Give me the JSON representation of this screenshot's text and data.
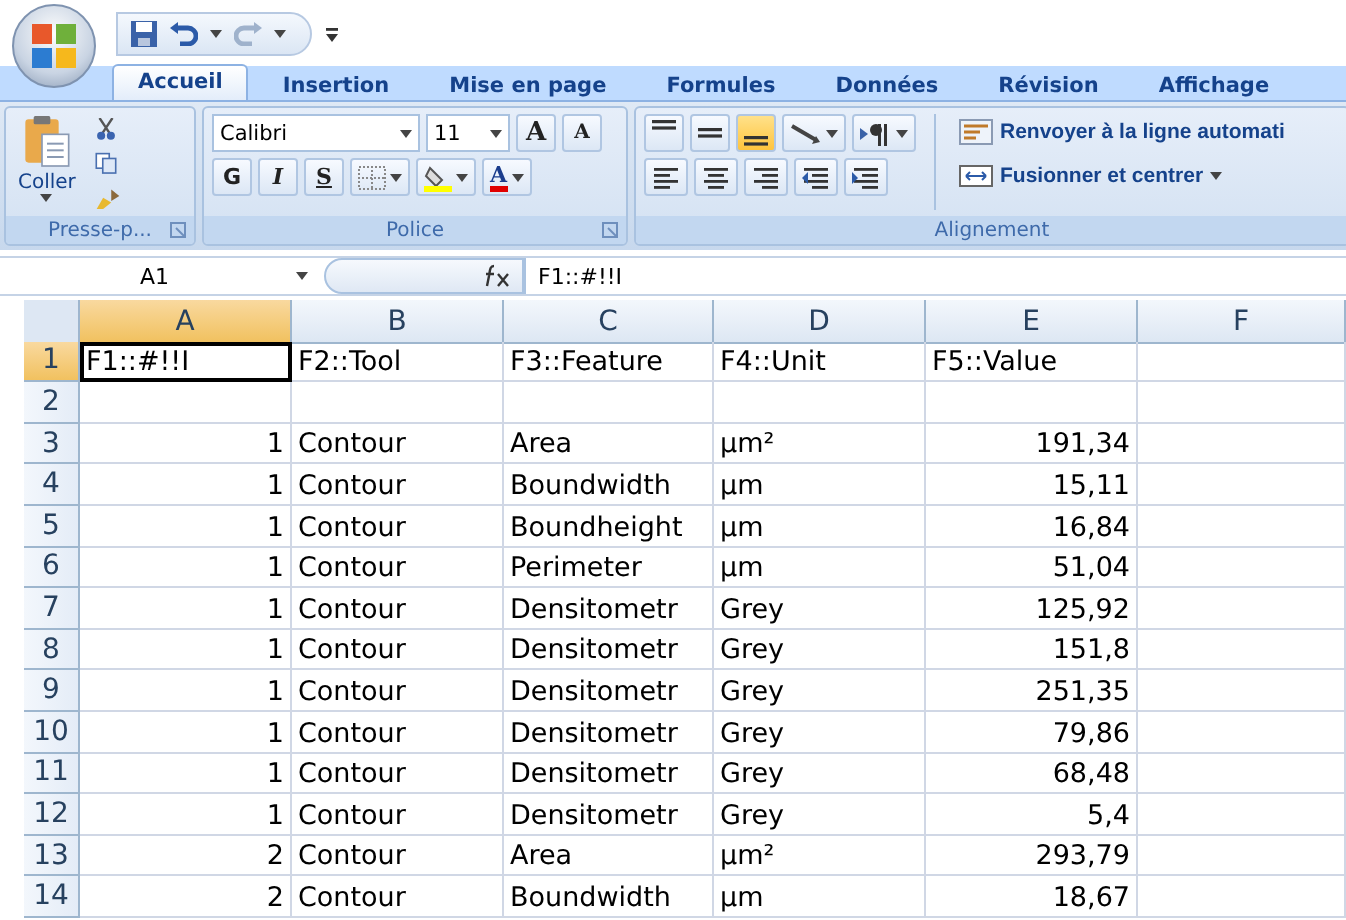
{
  "tabs": [
    {
      "label": "Accueil",
      "selected": true
    },
    {
      "label": "Insertion",
      "selected": false
    },
    {
      "label": "Mise en page",
      "selected": false
    },
    {
      "label": "Formules",
      "selected": false
    },
    {
      "label": "Données",
      "selected": false
    },
    {
      "label": "Révision",
      "selected": false
    },
    {
      "label": "Affichage",
      "selected": false
    }
  ],
  "clipboard": {
    "paste_label": "Coller",
    "group_label": "Presse-p..."
  },
  "font": {
    "name": "Calibri",
    "size": "11",
    "grow": "A",
    "shrink": "A",
    "bold": "G",
    "italic": "I",
    "underline": "S",
    "color_letter": "A",
    "group_label": "Police"
  },
  "alignment": {
    "vertical": [
      {
        "kind": "top",
        "selected": false
      },
      {
        "kind": "middle",
        "selected": false
      },
      {
        "kind": "bottom",
        "selected": true
      }
    ],
    "wrap": "Renvoyer à la ligne automati",
    "merge": "Fusionner et centrer",
    "group_label": "Alignement"
  },
  "formula_bar": {
    "name_box": "A1",
    "formula": "F1::#!!I"
  },
  "columns": [
    {
      "label": "A",
      "selected": true,
      "numeric": true
    },
    {
      "label": "B",
      "selected": false,
      "numeric": false
    },
    {
      "label": "C",
      "selected": false,
      "numeric": false
    },
    {
      "label": "D",
      "selected": false,
      "numeric": false
    },
    {
      "label": "E",
      "selected": false,
      "numeric": true
    },
    {
      "label": "F",
      "selected": false,
      "numeric": false
    }
  ],
  "rows": [
    {
      "label": "1",
      "selected": true,
      "kind": "header",
      "cells": [
        "F1::#!!I",
        "F2::Tool",
        "F3::Feature",
        "F4::Unit",
        "F5::Value"
      ]
    },
    {
      "label": "2",
      "selected": false,
      "kind": "data",
      "cells": []
    },
    {
      "label": "3",
      "selected": false,
      "kind": "data",
      "cells": [
        "1",
        "Contour",
        "Area",
        "µm²",
        "191,34"
      ]
    },
    {
      "label": "4",
      "selected": false,
      "kind": "data",
      "cells": [
        "1",
        "Contour",
        "Boundwidth",
        "µm",
        "15,11"
      ]
    },
    {
      "label": "5",
      "selected": false,
      "kind": "data",
      "cells": [
        "1",
        "Contour",
        "Boundheight",
        "µm",
        "16,84"
      ]
    },
    {
      "label": "6",
      "selected": false,
      "kind": "data",
      "cells": [
        "1",
        "Contour",
        "Perimeter",
        "µm",
        "51,04"
      ]
    },
    {
      "label": "7",
      "selected": false,
      "kind": "data",
      "cells": [
        "1",
        "Contour",
        "Densitometr",
        "Grey",
        "125,92"
      ]
    },
    {
      "label": "8",
      "selected": false,
      "kind": "data",
      "cells": [
        "1",
        "Contour",
        "Densitometr",
        "Grey",
        "151,8"
      ]
    },
    {
      "label": "9",
      "selected": false,
      "kind": "data",
      "cells": [
        "1",
        "Contour",
        "Densitometr",
        "Grey",
        "251,35"
      ]
    },
    {
      "label": "10",
      "selected": false,
      "kind": "data",
      "cells": [
        "1",
        "Contour",
        "Densitometr",
        "Grey",
        "79,86"
      ]
    },
    {
      "label": "11",
      "selected": false,
      "kind": "data",
      "cells": [
        "1",
        "Contour",
        "Densitometr",
        "Grey",
        "68,48"
      ]
    },
    {
      "label": "12",
      "selected": false,
      "kind": "data",
      "cells": [
        "1",
        "Contour",
        "Densitometr",
        "Grey",
        "5,4"
      ]
    },
    {
      "label": "13",
      "selected": false,
      "kind": "data",
      "cells": [
        "2",
        "Contour",
        "Area",
        "µm²",
        "293,79"
      ]
    },
    {
      "label": "14",
      "selected": false,
      "kind": "data",
      "cells": [
        "2",
        "Contour",
        "Boundwidth",
        "µm",
        "18,67"
      ]
    }
  ]
}
